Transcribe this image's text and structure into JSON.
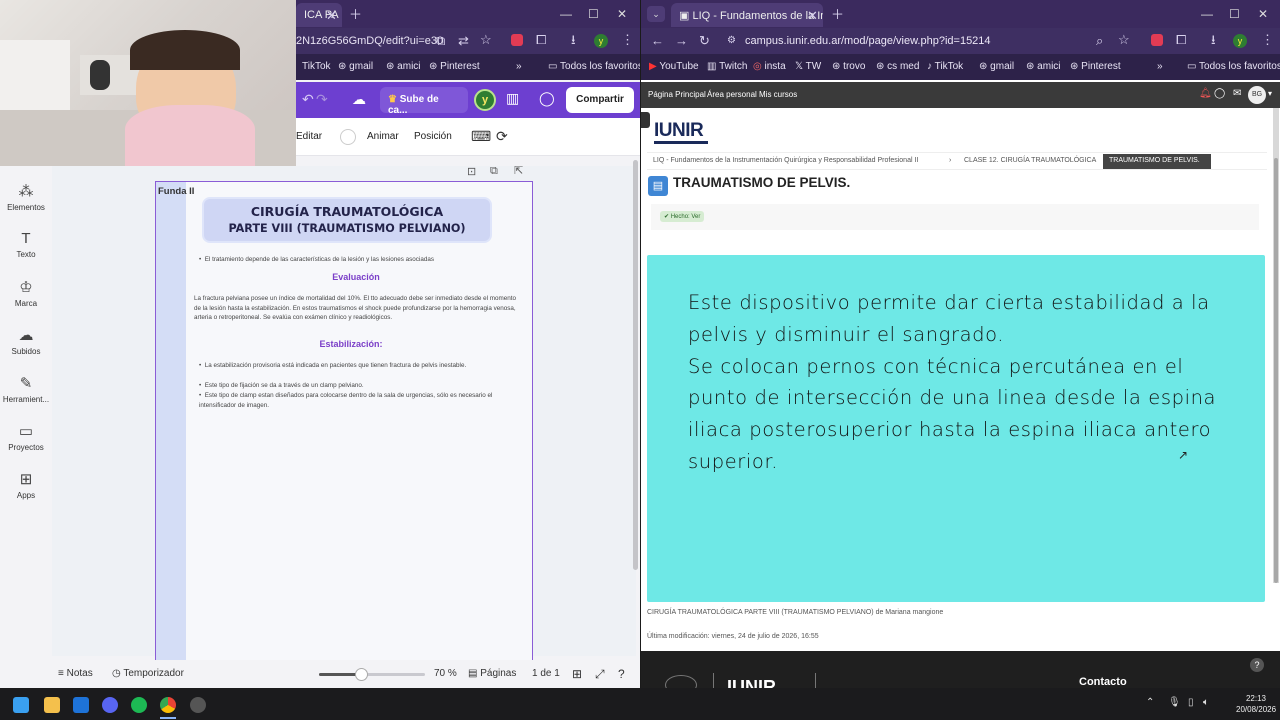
{
  "left_browser": {
    "tab_title": "ICA PA",
    "url": "2N1z6G56GmDQ/edit?ui=e30",
    "avatar": "y",
    "bookmarks": [
      "TikTok",
      "gmail",
      "amici",
      "Pinterest"
    ],
    "bookmarks_more": "Todos los favoritos"
  },
  "canva": {
    "upload_label": "Sube de ca...",
    "avatar": "y",
    "share_label": "Compartir",
    "tools": {
      "edit": "Editar",
      "animate": "Animar",
      "position": "Posición"
    },
    "sidebar": [
      {
        "label": "Elementos",
        "icon": "elements-icon"
      },
      {
        "label": "Texto",
        "icon": "text-icon"
      },
      {
        "label": "Marca",
        "icon": "brand-icon"
      },
      {
        "label": "Subidos",
        "icon": "uploads-icon"
      },
      {
        "label": "Herramient...",
        "icon": "tools-icon"
      },
      {
        "label": "Proyectos",
        "icon": "projects-icon"
      },
      {
        "label": "Apps",
        "icon": "apps-icon"
      }
    ],
    "page_label": "Funda II",
    "doc": {
      "title_line1": "CIRUGÍA TRAUMATOLÓGICA",
      "title_line2": "PARTE VIII (TRAUMATISMO PELVIANO)",
      "bullet_intro": "El tratamiento depende de las características de la lesión y las lesiones asociadas",
      "section1": "Evaluación",
      "para1": "La fractura pelviana posee un índice de mortalidad del 10%. El tto adecuado debe ser inmediato desde el momento de la lesión hasta la estabilización. En estos traumatismos el shock puede profundizarse por la hemorragia venosa, arteria o retroperitoneal. Se evalúa con exámen clínico y readiológicos.",
      "section2": "Estabilización:",
      "bullets": [
        "La estabilización provisoria está indicada en pacientes que tienen fractura de pelvis inestable.",
        "Este tipo de fijación se da a través de un clamp pelviano.",
        "Este tipo de clamp estan diseñados para colocarse dentro de la sala de urgencias, sólo es necesario el intensificador de imagen."
      ]
    },
    "bottom": {
      "notes": "Notas",
      "timer": "Temporizador",
      "zoom": "70 %",
      "zoom_fraction": 0.4,
      "pages": "Páginas",
      "page_count": "1 de 1"
    }
  },
  "right_browser": {
    "tab_title": "LIQ - Fundamentos de la Instru",
    "url": "campus.iunir.edu.ar/mod/page/view.php?id=15214",
    "avatar": "y",
    "bookmarks": [
      "YouTube",
      "Twitch",
      "insta",
      "TW",
      "trovo",
      "cs med",
      "TikTok",
      "gmail",
      "amici",
      "Pinterest"
    ],
    "bookmarks_more": "Todos los favoritos"
  },
  "moodle": {
    "nav": [
      "Página Principal",
      "Área personal",
      "Mis cursos"
    ],
    "user_initials": "BG",
    "logo": "IUNIR",
    "breadcrumb": [
      "LIQ - Fundamentos de la Instrumentación Quirúrgica y Responsabilidad Profesional II",
      "CLASE 12. CIRUGÍA TRAUMATOLÓGICA",
      "TRAUMATISMO DE PELVIS."
    ],
    "page_title": "TRAUMATISMO DE PELVIS.",
    "done_badge": "✔ Hecho: Ver",
    "slide_lines": [
      "Este dispositivo permite dar cierta estabilidad a la",
      "pelvis y disminuir el sangrado.",
      "Se colocan pernos con técnica percutánea en el",
      "punto de intersección de una linea desde la espina",
      "iliaca posterosuperior hasta la espina iliaca antero",
      "superior."
    ],
    "embed_caption": "CIRUGÍA TRAUMATOLÓGICA PARTE VIII (TRAUMATISMO PELVIANO) de Mariana mangione",
    "last_modified": "Última modificación: viernes, 24 de julio de 2026, 16:55",
    "footer_contact": "Contacto",
    "footer_logo": "IUNIR",
    "help": "?"
  },
  "taskbar": {
    "time": "22:13",
    "date": "20/08/2026"
  }
}
